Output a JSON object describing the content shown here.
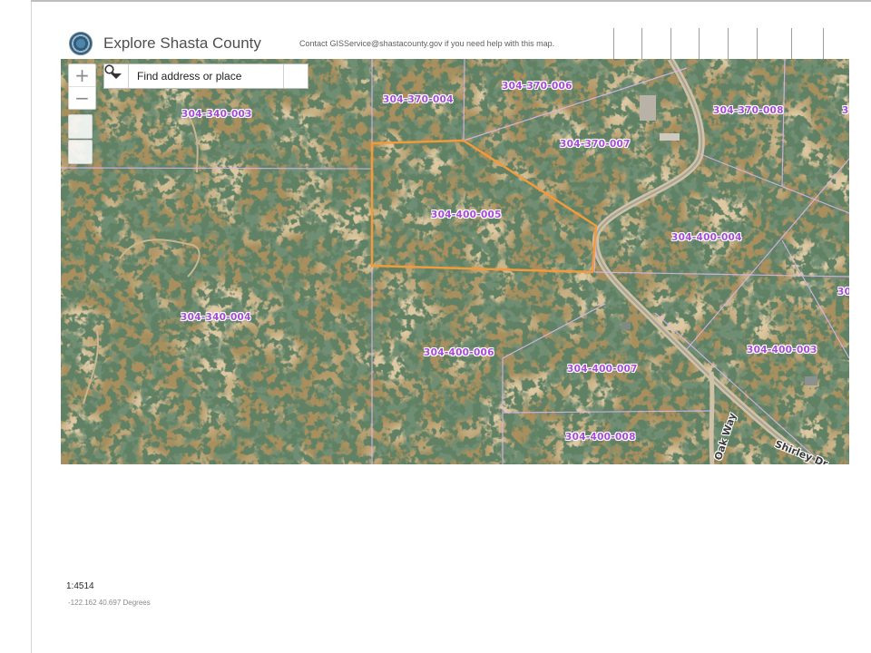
{
  "header": {
    "title": "Explore Shasta County",
    "contact_note": "Contact GISService@shastacounty.gov if you need help with this map."
  },
  "search": {
    "placeholder": "Find address or place"
  },
  "zoom": {
    "zoom_in_label": "+",
    "zoom_out_label": "−"
  },
  "icons": {
    "logo": "shasta-county-seal-icon",
    "dropdown": "caret-down-icon",
    "search": "search-icon"
  },
  "map": {
    "parcels": [
      {
        "id": "304-340-003"
      },
      {
        "id": "304-370-004"
      },
      {
        "id": "304-370-006"
      },
      {
        "id": "304-370-007"
      },
      {
        "id": "304-370-008"
      },
      {
        "id": "304-400-005"
      },
      {
        "id": "304-400-004"
      },
      {
        "id": "304-340-004"
      },
      {
        "id": "304-400-006"
      },
      {
        "id": "304-400-007"
      },
      {
        "id": "304-400-003"
      },
      {
        "id": "304-400-008"
      },
      {
        "id": "3"
      },
      {
        "id": "30"
      }
    ],
    "roads": [
      {
        "name": "Oak Way"
      },
      {
        "name": "Shirley Dr"
      }
    ],
    "selected_parcel": "304-400-005",
    "colors": {
      "highlight": "#f39a3a",
      "parcel_line": "#d9b6e8",
      "parcel_label": "#a64ad6"
    }
  },
  "footer": {
    "scale": "1:4514",
    "coordinates": "-122.162 40.697 Degrees"
  }
}
